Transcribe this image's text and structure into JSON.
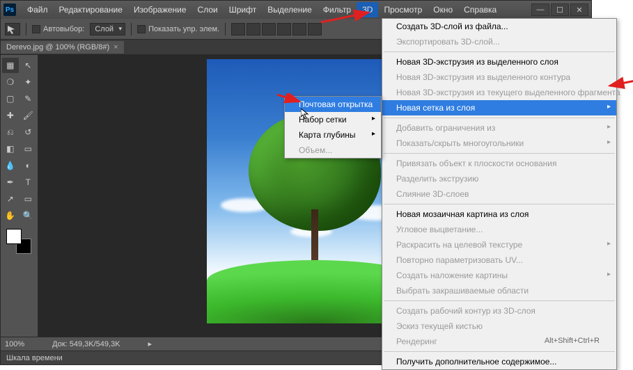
{
  "app": {
    "logo": "Ps"
  },
  "menu": [
    "Файл",
    "Редактирование",
    "Изображение",
    "Слои",
    "Шрифт",
    "Выделение",
    "Фильтр",
    "3D",
    "Просмотр",
    "Окно",
    "Справка"
  ],
  "active_menu_index": 7,
  "options": {
    "autoselect_label": "Автовыбор:",
    "autoselect_mode": "Слой",
    "show_controls_label": "Показать упр. элем."
  },
  "document_tab": {
    "title": "Derevo.jpg @ 100% (RGB/8#)",
    "close": "×"
  },
  "status": {
    "zoom": "100%",
    "doc_info": "Док: 549,3K/549,3K"
  },
  "timeline_label": "Шкала времени",
  "menu_3d": {
    "groups": [
      {
        "items": [
          {
            "label": "Создать 3D-слой из файла...",
            "enabled": true
          },
          {
            "label": "Экспортировать 3D-слой...",
            "enabled": false
          }
        ]
      },
      {
        "items": [
          {
            "label": "Новая 3D-экструзия из выделенного слоя",
            "enabled": true
          },
          {
            "label": "Новая 3D-экструзия из выделенного контура",
            "enabled": false
          },
          {
            "label": "Новая 3D-экструзия из текущего выделенного фрагмента",
            "enabled": false
          },
          {
            "label": "Новая сетка из слоя",
            "enabled": true,
            "highlight": true,
            "submenu": true
          }
        ]
      },
      {
        "items": [
          {
            "label": "Добавить ограничения из",
            "enabled": false,
            "submenu": true
          },
          {
            "label": "Показать/скрыть многоугольники",
            "enabled": false,
            "submenu": true
          }
        ]
      },
      {
        "items": [
          {
            "label": "Привязать объект к плоскости основания",
            "enabled": false
          },
          {
            "label": "Разделить экструзию",
            "enabled": false
          },
          {
            "label": "Слияние 3D-слоев",
            "enabled": false
          }
        ]
      },
      {
        "items": [
          {
            "label": "Новая мозаичная картина из слоя",
            "enabled": true
          },
          {
            "label": "Угловое выцветание...",
            "enabled": false
          },
          {
            "label": "Раскрасить на целевой текстуре",
            "enabled": false,
            "submenu": true
          },
          {
            "label": "Повторно параметризовать UV...",
            "enabled": false
          },
          {
            "label": "Создать наложение картины",
            "enabled": false,
            "submenu": true
          },
          {
            "label": "Выбрать закрашиваемые области",
            "enabled": false
          }
        ]
      },
      {
        "items": [
          {
            "label": "Создать рабочий контур из 3D-слоя",
            "enabled": false
          },
          {
            "label": "Эскиз текущей кистью",
            "enabled": false
          },
          {
            "label": "Рендеринг",
            "enabled": false,
            "shortcut": "Alt+Shift+Ctrl+R"
          }
        ]
      },
      {
        "items": [
          {
            "label": "Получить дополнительное содержимое...",
            "enabled": true
          }
        ]
      }
    ]
  },
  "submenu_mesh": {
    "items": [
      {
        "label": "Почтовая открытка",
        "highlight": true
      },
      {
        "label": "Набор сетки",
        "submenu": true
      },
      {
        "label": "Карта глубины",
        "submenu": true
      },
      {
        "label": "Объем...",
        "enabled": false
      }
    ]
  }
}
